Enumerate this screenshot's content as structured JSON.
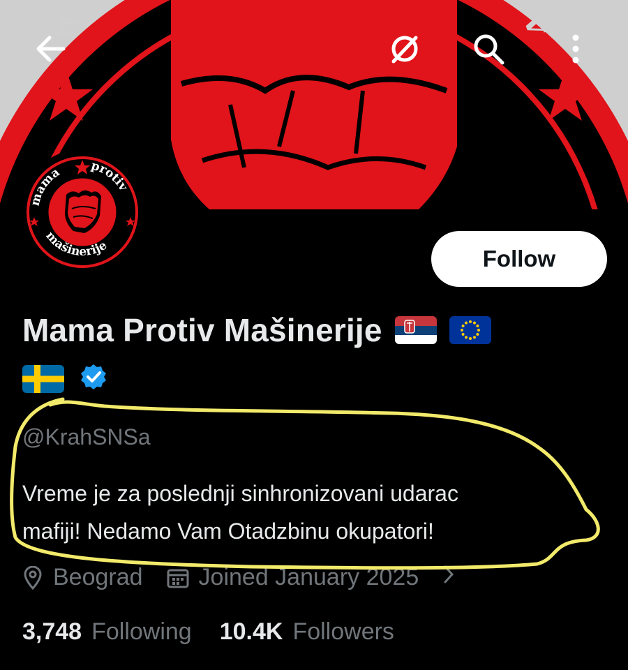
{
  "profile": {
    "display_name": "Mama Protiv Mašinerije",
    "handle": "@KrahSNSa",
    "bio_line1": "Vreme je za poslednji sinhronizovani udarac",
    "bio_line2": "mafiji! Nedamo Vam Otadzbinu okupatori!",
    "location": "Beograd",
    "joined": "Joined January 2025",
    "following_count": "3,748",
    "following_label": "Following",
    "followers_count": "10.4K",
    "followers_label": "Followers",
    "flags": [
      "serbia-flag",
      "eu-flag",
      "sweden-flag"
    ],
    "verified": true
  },
  "avatar_text": {
    "top_left": "mama",
    "top_right": "protiv",
    "bottom": "mašinerije"
  },
  "buttons": {
    "follow_label": "Follow"
  },
  "icons": {
    "back": "back-arrow-icon",
    "grok": "grok-icon",
    "search": "search-icon",
    "more": "more-vertical-icon",
    "location": "location-pin-icon",
    "calendar": "calendar-icon",
    "chevron": "chevron-right-icon"
  },
  "colors": {
    "background": "#000000",
    "text": "#e7e9ea",
    "secondary": "#71767b",
    "verified": "#1d9bf0",
    "banner_red": "#e0141a",
    "highlight": "#f2ea6a"
  }
}
